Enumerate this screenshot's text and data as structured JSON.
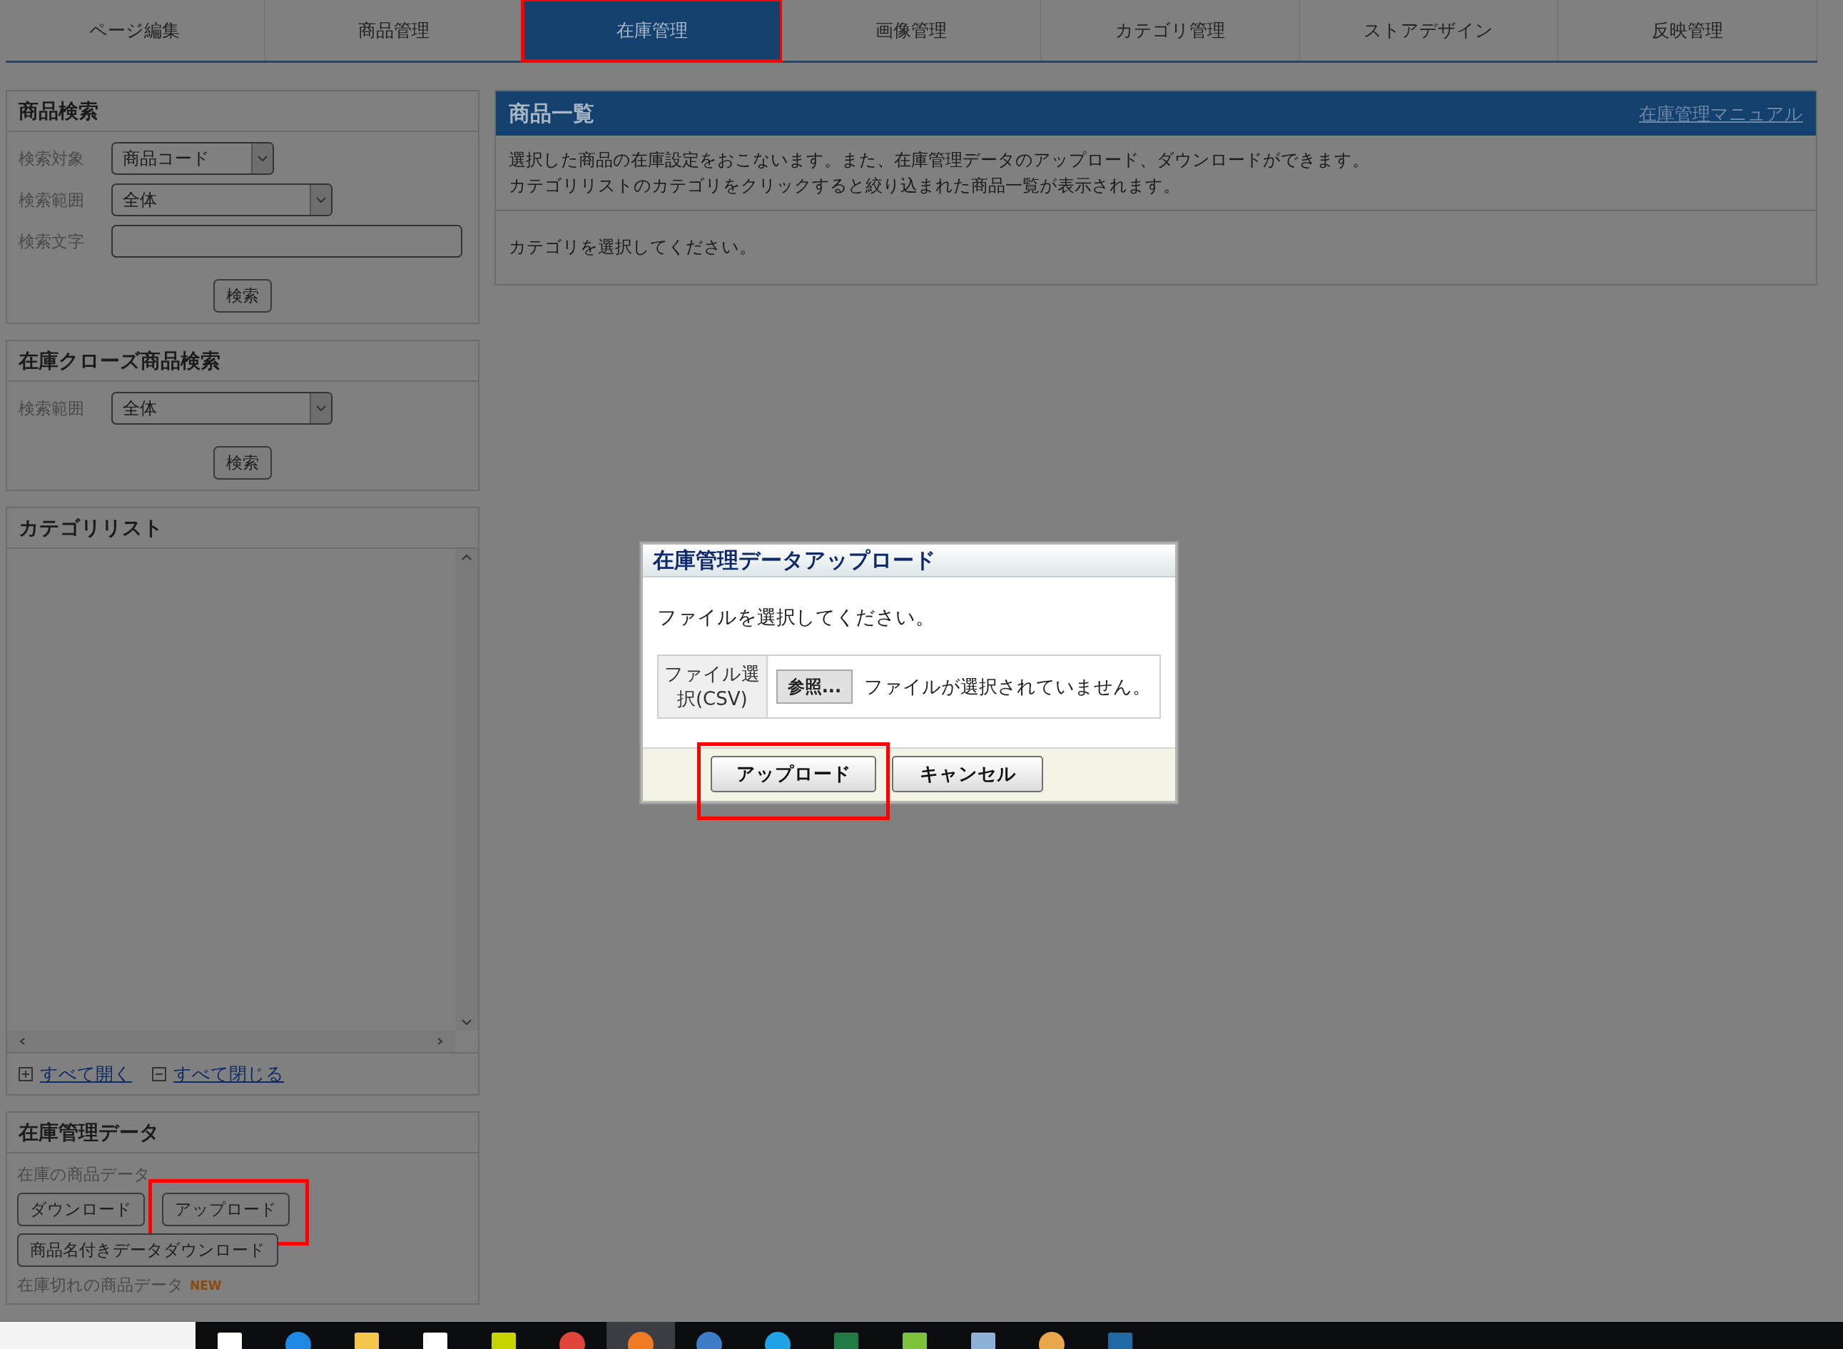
{
  "tabs": [
    {
      "label": "ページ編集",
      "selected": false,
      "highlighted": false
    },
    {
      "label": "商品管理",
      "selected": false,
      "highlighted": false
    },
    {
      "label": "在庫管理",
      "selected": true,
      "highlighted": true
    },
    {
      "label": "画像管理",
      "selected": false,
      "highlighted": false
    },
    {
      "label": "カテゴリ管理",
      "selected": false,
      "highlighted": false
    },
    {
      "label": "ストアデザイン",
      "selected": false,
      "highlighted": false
    },
    {
      "label": "反映管理",
      "selected": false,
      "highlighted": false
    }
  ],
  "sidebar": {
    "product_search": {
      "title": "商品検索",
      "fields": [
        {
          "label": "検索対象",
          "kind": "select",
          "value": "商品コード"
        },
        {
          "label": "検索範囲",
          "kind": "select",
          "value": "全体"
        },
        {
          "label": "検索文字",
          "kind": "text"
        }
      ],
      "button": "検索"
    },
    "closed_search": {
      "title": "在庫クローズ商品検索",
      "fields": [
        {
          "label": "検索範囲",
          "kind": "select",
          "value": "全体"
        }
      ],
      "button": "検索"
    },
    "category_list": {
      "title": "カテゴリリスト",
      "links": [
        {
          "kind": "expand",
          "label": "すべて開く"
        },
        {
          "kind": "collapse",
          "label": "すべて閉じる"
        }
      ]
    },
    "stock_data": {
      "title": "在庫管理データ",
      "subtitle": "在庫の商品データ",
      "buttons": [
        {
          "label": "ダウンロード",
          "highlighted": false
        },
        {
          "label": "アップロード",
          "highlighted": true
        },
        {
          "label": "商品名付きデータダウンロード",
          "highlighted": false
        }
      ],
      "subtitle_2": "在庫切れの商品データ",
      "badge": "NEW"
    }
  },
  "main": {
    "title": "商品一覧",
    "manual_link": "在庫管理マニュアル",
    "description": [
      "選択した商品の在庫設定をおこないます。また、在庫管理データのアップロード、ダウンロードができます。",
      "カテゴリリストのカテゴリをクリックすると絞り込まれた商品一覧が表示されます。"
    ],
    "message": "カテゴリを選択してください。"
  },
  "dialog": {
    "title": "在庫管理データアップロード",
    "prompt": "ファイルを選択してください。",
    "file_label": "ファイル選択(CSV)",
    "browse_button": "参照...",
    "file_status": "ファイルが選択されていません。",
    "buttons": [
      {
        "label": "アップロード",
        "highlighted": true
      },
      {
        "label": "キャンセル",
        "highlighted": false
      }
    ]
  },
  "taskbar": {
    "apps": [
      {
        "kind": "window",
        "selected": false
      },
      {
        "kind": "edge",
        "selected": false
      },
      {
        "kind": "folder",
        "selected": false
      },
      {
        "kind": "bag",
        "selected": false
      },
      {
        "kind": "ftp",
        "selected": false
      },
      {
        "kind": "chrome",
        "selected": false
      },
      {
        "kind": "firefox",
        "selected": true
      },
      {
        "kind": "globe",
        "selected": false
      },
      {
        "kind": "skype",
        "selected": false
      },
      {
        "kind": "excel",
        "selected": false
      },
      {
        "kind": "dw",
        "selected": false
      },
      {
        "kind": "note",
        "selected": false
      },
      {
        "kind": "paint",
        "selected": false
      },
      {
        "kind": "ps",
        "selected": false
      }
    ]
  }
}
